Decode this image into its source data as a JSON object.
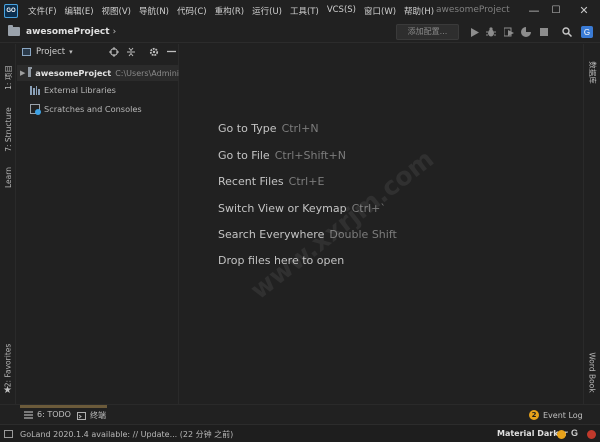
{
  "titlebar": {
    "app_logo": "GO",
    "menu": [
      "文件(F)",
      "编辑(E)",
      "视图(V)",
      "导航(N)",
      "代码(C)",
      "重构(R)",
      "运行(U)",
      "工具(T)",
      "VCS(S)",
      "窗口(W)",
      "帮助(H)"
    ],
    "window_title": "awesomeProject",
    "minimize": "—",
    "maximize": "☐",
    "close": "✕"
  },
  "navbar": {
    "project": "awesomeProject",
    "chevron": "›",
    "add_config": "添加配置...",
    "toolbar_icons": [
      "run-icon",
      "debug-icon",
      "coverage-icon",
      "profile-icon",
      "stop-icon",
      "search-icon",
      "translate-icon"
    ]
  },
  "left_stripe": {
    "tabs": [
      "1: 项目",
      "7: Structure",
      "Learn",
      "2: Favorites"
    ]
  },
  "project_panel": {
    "title": "Project",
    "dropdown": "▾",
    "tree": [
      {
        "label": "awesomeProject",
        "path": "C:\\Users\\Admini"
      },
      {
        "label": "External Libraries"
      },
      {
        "label": "Scratches and Consoles"
      }
    ]
  },
  "editor": {
    "hints": [
      {
        "label": "Go to Type",
        "key": "Ctrl+N"
      },
      {
        "label": "Go to File",
        "key": "Ctrl+Shift+N"
      },
      {
        "label": "Recent Files",
        "key": "Ctrl+E"
      },
      {
        "label": "Switch View or Keymap",
        "key": "Ctrl+`"
      },
      {
        "label": "Search Everywhere",
        "key": "Double Shift"
      },
      {
        "label": "Drop files here to open",
        "key": ""
      }
    ]
  },
  "right_stripe": {
    "tabs": [
      "数据库",
      "Word Book"
    ]
  },
  "bottom_tools": {
    "todo": "6: TODO",
    "terminal": "终端",
    "event_log": "Event Log",
    "event_count": "2"
  },
  "statusbar": {
    "text": "GoLand 2020.1.4 available: // Update... (22 分钟 之前)",
    "theme": "Material Darker"
  },
  "watermark": "www.xxrjm.com",
  "colors": {
    "background": "#212121",
    "accent_blue": "#3ea2e5",
    "event_orange": "#e8a21a",
    "error_red": "#c0392b"
  }
}
